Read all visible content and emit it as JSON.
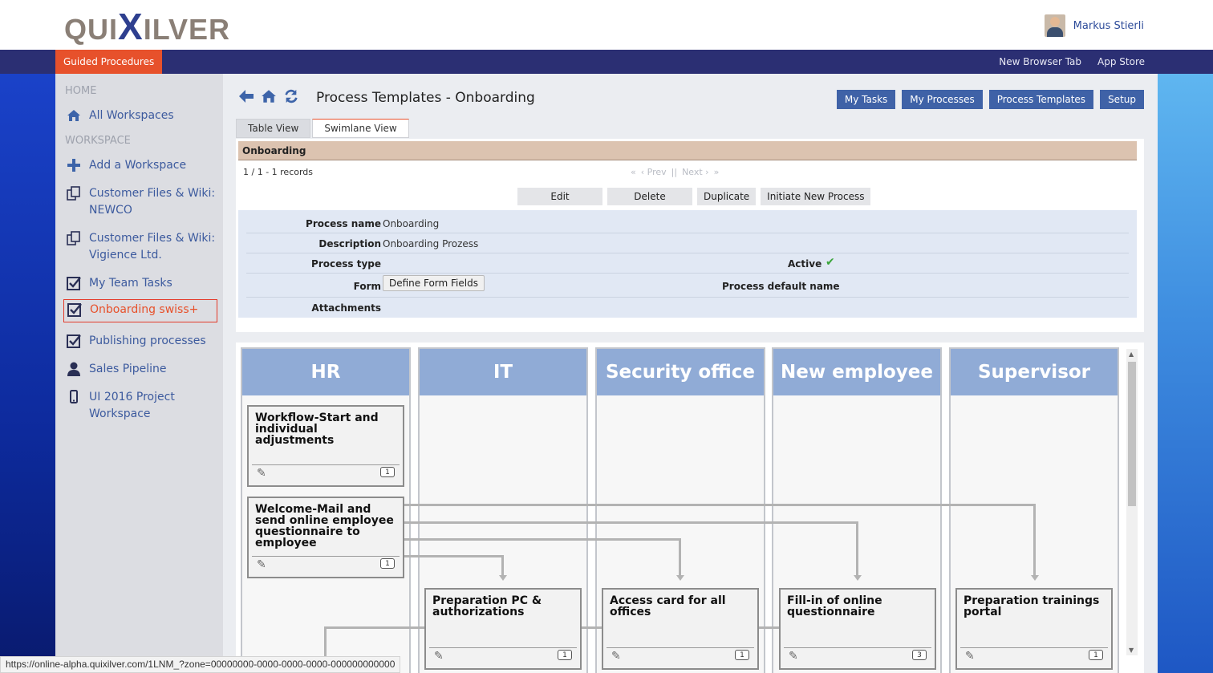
{
  "header": {
    "logo_left": "QUI",
    "logo_x": "X",
    "logo_right": "ILVER",
    "user_name": "Markus Stierli"
  },
  "navbar": {
    "active": "Guided Procedures",
    "links": [
      "New Browser Tab",
      "App Store"
    ]
  },
  "sidebar": {
    "home_heading": "HOME",
    "workspace_heading": "WORKSPACE",
    "all_workspaces": "All Workspaces",
    "add_workspace": "Add a Workspace",
    "items": [
      {
        "label": "Customer Files & Wiki: NEWCO",
        "icon": "copy-icon"
      },
      {
        "label": "Customer Files & Wiki: Vigience Ltd.",
        "icon": "copy-icon"
      },
      {
        "label": "My Team Tasks",
        "icon": "checkbox-icon"
      },
      {
        "label": "Onboarding swiss+",
        "icon": "checkbox-icon"
      },
      {
        "label": "Publishing processes",
        "icon": "checkbox-icon"
      },
      {
        "label": "Sales Pipeline",
        "icon": "user-icon"
      },
      {
        "label": "UI 2016 Project Workspace",
        "icon": "mobile-icon"
      }
    ]
  },
  "main": {
    "title": "Process Templates - Onboarding",
    "top_buttons": [
      "My Tasks",
      "My Processes",
      "Process Templates",
      "Setup"
    ],
    "tabs": [
      "Table View",
      "Swimlane View"
    ],
    "card_title": "Onboarding",
    "records": "1 / 1 - 1 records",
    "pager": {
      "first": "«",
      "prev": "‹ Prev",
      "sep": "||",
      "next": "Next ›",
      "last": "»"
    },
    "actions": [
      "Edit",
      "Delete",
      "Duplicate",
      "Initiate New Process"
    ],
    "props": {
      "process_name_label": "Process name",
      "process_name": "Onboarding",
      "description_label": "Description",
      "description": "Onboarding Prozess",
      "process_type_label": "Process type",
      "active_label": "Active",
      "form_label": "Form",
      "form_button": "Define Form Fields",
      "default_name_label": "Process default name",
      "attachments_label": "Attachments"
    }
  },
  "swimlanes": {
    "lanes": [
      "HR",
      "IT",
      "Security office",
      "New employee",
      "Supervisor"
    ],
    "tasks": [
      {
        "title": "Workflow-Start and individual adjustments",
        "count": "1"
      },
      {
        "title": "Welcome-Mail and send online employee questionnaire to employee",
        "count": "1"
      },
      {
        "title": "Preparation PC & authorizations",
        "count": "1"
      },
      {
        "title": "Access card for all offices",
        "count": "1"
      },
      {
        "title": "Fill-in of online questionnaire",
        "count": "3"
      },
      {
        "title": "Preparation trainings portal",
        "count": "1"
      }
    ]
  },
  "status_url": "https://online-alpha.quixilver.com/1LNM_?zone=00000000-0000-0000-0000-000000000000"
}
